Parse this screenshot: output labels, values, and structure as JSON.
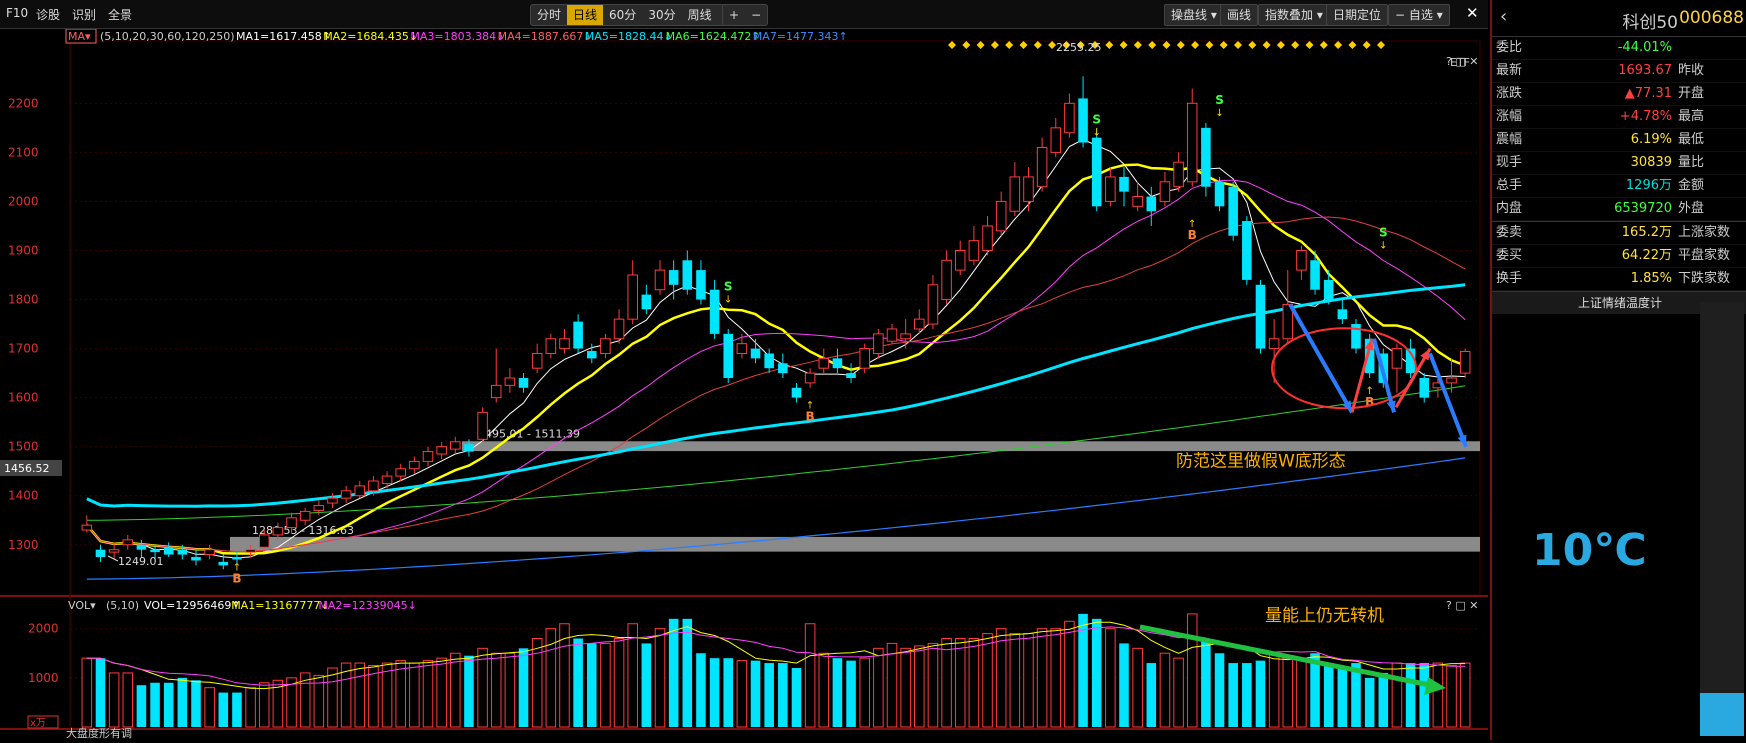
{
  "toolbar": {
    "left_items": [
      "F10",
      "诊股",
      "识别",
      "全景"
    ],
    "periods": [
      "分时",
      "日线",
      "60分",
      "30分",
      "周线"
    ],
    "active_period": "日线",
    "zoom_in": "+",
    "zoom_out": "−",
    "right_items": [
      "操盘线",
      "画线",
      "指数叠加",
      "日期定位",
      "自选"
    ]
  },
  "main_chart": {
    "indicator_name": "MA",
    "ma_params": "(5,10,20,30,60,120,250)",
    "ma_readouts": [
      {
        "label": "MA1=1617.458↑",
        "color": "#ffffff"
      },
      {
        "label": "MA2=1684.435↓",
        "color": "#ffff00"
      },
      {
        "label": "MA3=1803.384↓",
        "color": "#ff40ff"
      },
      {
        "label": "MA4=1887.667↓",
        "color": "#ff6060"
      },
      {
        "label": "MA5=1828.44↓",
        "color": "#00e5ff"
      },
      {
        "label": "MA6=1624.472↑",
        "color": "#40ff40"
      },
      {
        "label": "MA7=1477.343↑",
        "color": "#3a8cff"
      }
    ],
    "etf_label": "ETF",
    "peak_label": "2255.25",
    "price_ticks": [
      "2200",
      "2100",
      "2000",
      "1900",
      "1800",
      "1700",
      "1600",
      "1500",
      "1400",
      "1300"
    ],
    "current_price_tag": "1456.52",
    "low_label": "1249.01",
    "zone_upper_label": "1495.01 - 1511.39",
    "zone_lower_label": "1286.53 - 1316.63",
    "annotation_w": "防范这里做假W底形态",
    "buy_mark": "B",
    "sell_mark": "S"
  },
  "volume_chart": {
    "name": "VOL",
    "params": "(5,10)",
    "readouts": [
      {
        "label": "VOL=12956469↑",
        "color": "#ffffff"
      },
      {
        "label": "MA1=13167777↓",
        "color": "#ffff00"
      },
      {
        "label": "MA2=12339045↓",
        "color": "#ff40ff"
      }
    ],
    "ticks": [
      "2000",
      "1000"
    ],
    "unit": "x万",
    "annotation": "量能上仍无转机",
    "bottom_label": "大盘度形有调"
  },
  "colors": {
    "up": "#ff3b3b",
    "down": "#00e5ff",
    "ma1": "#ffffff",
    "ma2": "#ffff00",
    "ma3": "#ff40ff",
    "ma4": "#e04040",
    "ma5": "#00e5ff",
    "ma6": "#30d030",
    "ma7": "#2a7cff"
  },
  "chart_data": {
    "type": "candlestick",
    "ylim": [
      1220,
      2270
    ],
    "candles": [
      [
        1330,
        1340,
        1360,
        1325
      ],
      [
        1290,
        1275,
        1300,
        1265
      ],
      [
        1285,
        1290,
        1305,
        1270
      ],
      [
        1300,
        1310,
        1320,
        1290
      ],
      [
        1300,
        1290,
        1310,
        1275
      ],
      [
        1290,
        1285,
        1300,
        1270
      ],
      [
        1295,
        1280,
        1305,
        1275
      ],
      [
        1290,
        1280,
        1300,
        1270
      ],
      [
        1275,
        1268,
        1290,
        1258
      ],
      [
        1280,
        1290,
        1300,
        1270
      ],
      [
        1265,
        1258,
        1280,
        1250
      ],
      [
        1275,
        1270,
        1285,
        1262
      ],
      [
        1285,
        1290,
        1300,
        1275
      ],
      [
        1295,
        1320,
        1330,
        1290
      ],
      [
        1320,
        1335,
        1345,
        1310
      ],
      [
        1335,
        1355,
        1365,
        1325
      ],
      [
        1350,
        1368,
        1375,
        1340
      ],
      [
        1370,
        1380,
        1390,
        1360
      ],
      [
        1385,
        1395,
        1405,
        1375
      ],
      [
        1395,
        1410,
        1420,
        1385
      ],
      [
        1400,
        1420,
        1430,
        1395
      ],
      [
        1410,
        1430,
        1440,
        1400
      ],
      [
        1425,
        1440,
        1450,
        1415
      ],
      [
        1440,
        1455,
        1465,
        1430
      ],
      [
        1455,
        1470,
        1480,
        1445
      ],
      [
        1470,
        1490,
        1500,
        1460
      ],
      [
        1485,
        1500,
        1510,
        1475
      ],
      [
        1495,
        1510,
        1520,
        1485
      ],
      [
        1505,
        1490,
        1515,
        1480
      ],
      [
        1515,
        1570,
        1580,
        1510
      ],
      [
        1600,
        1625,
        1700,
        1590
      ],
      [
        1625,
        1640,
        1660,
        1610
      ],
      [
        1640,
        1620,
        1650,
        1610
      ],
      [
        1660,
        1690,
        1710,
        1650
      ],
      [
        1690,
        1720,
        1730,
        1680
      ],
      [
        1700,
        1720,
        1740,
        1690
      ],
      [
        1755,
        1700,
        1770,
        1690
      ],
      [
        1695,
        1680,
        1710,
        1670
      ],
      [
        1690,
        1720,
        1730,
        1680
      ],
      [
        1720,
        1760,
        1780,
        1710
      ],
      [
        1760,
        1850,
        1880,
        1750
      ],
      [
        1810,
        1780,
        1830,
        1770
      ],
      [
        1820,
        1860,
        1880,
        1810
      ],
      [
        1860,
        1830,
        1880,
        1800
      ],
      [
        1880,
        1820,
        1900,
        1810
      ],
      [
        1860,
        1800,
        1880,
        1790
      ],
      [
        1820,
        1730,
        1840,
        1720
      ],
      [
        1730,
        1640,
        1740,
        1630
      ],
      [
        1690,
        1710,
        1730,
        1680
      ],
      [
        1700,
        1680,
        1720,
        1670
      ],
      [
        1690,
        1660,
        1700,
        1650
      ],
      [
        1670,
        1650,
        1690,
        1640
      ],
      [
        1620,
        1600,
        1630,
        1590
      ],
      [
        1630,
        1650,
        1660,
        1620
      ],
      [
        1660,
        1680,
        1700,
        1650
      ],
      [
        1680,
        1660,
        1700,
        1650
      ],
      [
        1650,
        1640,
        1670,
        1630
      ],
      [
        1660,
        1700,
        1710,
        1650
      ],
      [
        1690,
        1730,
        1740,
        1680
      ],
      [
        1715,
        1740,
        1750,
        1710
      ],
      [
        1720,
        1730,
        1760,
        1700
      ],
      [
        1740,
        1760,
        1780,
        1730
      ],
      [
        1750,
        1830,
        1850,
        1740
      ],
      [
        1800,
        1880,
        1900,
        1790
      ],
      [
        1860,
        1900,
        1920,
        1850
      ],
      [
        1880,
        1920,
        1950,
        1870
      ],
      [
        1900,
        1950,
        1970,
        1890
      ],
      [
        1940,
        2000,
        2020,
        1930
      ],
      [
        1980,
        2050,
        2080,
        1970
      ],
      [
        2000,
        2050,
        2070,
        1980
      ],
      [
        2030,
        2110,
        2130,
        2020
      ],
      [
        2100,
        2150,
        2170,
        2090
      ],
      [
        2140,
        2200,
        2220,
        2130
      ],
      [
        2210,
        2120,
        2255,
        2110
      ],
      [
        2130,
        1990,
        2150,
        1980
      ],
      [
        2000,
        2050,
        2070,
        1990
      ],
      [
        2050,
        2020,
        2070,
        1990
      ],
      [
        1990,
        2010,
        2040,
        1980
      ],
      [
        2010,
        1980,
        2030,
        1950
      ],
      [
        2000,
        2040,
        2060,
        1990
      ],
      [
        2030,
        2080,
        2100,
        2020
      ],
      [
        2040,
        2200,
        2230,
        2030
      ],
      [
        2150,
        2030,
        2160,
        2010
      ],
      [
        2040,
        1990,
        2050,
        1980
      ],
      [
        2030,
        1930,
        2040,
        1920
      ],
      [
        1960,
        1840,
        1970,
        1830
      ],
      [
        1830,
        1700,
        1840,
        1690
      ],
      [
        1700,
        1720,
        1760,
        1630
      ],
      [
        1720,
        1790,
        1860,
        1710
      ],
      [
        1860,
        1900,
        1910,
        1840
      ],
      [
        1880,
        1820,
        1900,
        1810
      ],
      [
        1840,
        1800,
        1860,
        1790
      ],
      [
        1780,
        1760,
        1800,
        1750
      ],
      [
        1750,
        1700,
        1760,
        1690
      ],
      [
        1720,
        1650,
        1730,
        1640
      ],
      [
        1690,
        1630,
        1700,
        1620
      ],
      [
        1660,
        1700,
        1710,
        1610
      ],
      [
        1700,
        1650,
        1720,
        1640
      ],
      [
        1640,
        1600,
        1650,
        1590
      ],
      [
        1620,
        1630,
        1640,
        1600
      ],
      [
        1630,
        1640,
        1680,
        1610
      ],
      [
        1650,
        1694,
        1700,
        1640
      ]
    ],
    "volumes": [
      1400,
      1400,
      1100,
      1100,
      850,
      900,
      900,
      1000,
      950,
      800,
      700,
      700,
      800,
      900,
      950,
      1000,
      1100,
      1050,
      1200,
      1300,
      1300,
      1250,
      1300,
      1350,
      1300,
      1350,
      1400,
      1500,
      1450,
      1600,
      1500,
      1500,
      1600,
      1800,
      2000,
      2100,
      1800,
      1700,
      1700,
      1800,
      2100,
      1700,
      2000,
      2200,
      2200,
      1500,
      1400,
      1400,
      1350,
      1350,
      1300,
      1300,
      1200,
      2100,
      1500,
      1400,
      1350,
      1400,
      1600,
      1700,
      1600,
      1650,
      1700,
      1800,
      1800,
      1800,
      1900,
      2000,
      1900,
      1900,
      2000,
      2000,
      2150,
      2300,
      2200,
      2000,
      1700,
      1600,
      1300,
      1500,
      1400,
      2300,
      1800,
      1500,
      1300,
      1300,
      1350,
      1500,
      1400,
      1400,
      1500,
      1300,
      1200,
      1300,
      1000,
      1100,
      1300,
      1300,
      1300,
      1300,
      1250,
      1300
    ]
  }
}
